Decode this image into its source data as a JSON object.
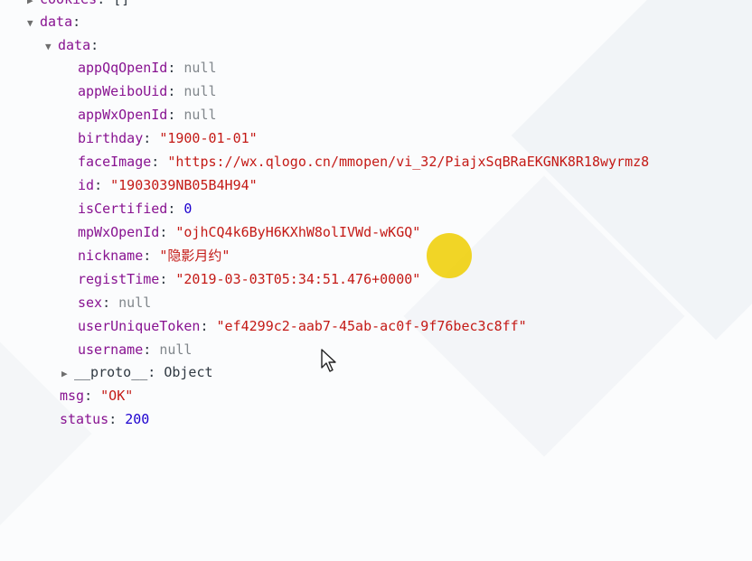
{
  "cookies": {
    "key": "cookies",
    "value": "[]"
  },
  "data_outer": {
    "key": "data"
  },
  "data_inner": {
    "key": "data"
  },
  "fields": [
    {
      "key": "appQqOpenId",
      "value": "null",
      "type": "null"
    },
    {
      "key": "appWeiboUid",
      "value": "null",
      "type": "null"
    },
    {
      "key": "appWxOpenId",
      "value": "null",
      "type": "null"
    },
    {
      "key": "birthday",
      "value": "\"1900-01-01\"",
      "type": "str"
    },
    {
      "key": "faceImage",
      "value": "\"https://wx.qlogo.cn/mmopen/vi_32/PiajxSqBRaEKGNK8R18wyrmz8",
      "type": "str"
    },
    {
      "key": "id",
      "value": "\"1903039NB05B4H94\"",
      "type": "str"
    },
    {
      "key": "isCertified",
      "value": "0",
      "type": "num"
    },
    {
      "key": "mpWxOpenId",
      "value": "\"ojhCQ4k6ByH6KXhW8olIVWd-wKGQ\"",
      "type": "str"
    },
    {
      "key": "nickname",
      "value": "\"隐影月约\"",
      "type": "str"
    },
    {
      "key": "registTime",
      "value": "\"2019-03-03T05:34:51.476+0000\"",
      "type": "str"
    },
    {
      "key": "sex",
      "value": "null",
      "type": "null"
    },
    {
      "key": "userUniqueToken",
      "value": "\"ef4299c2-aab7-45ab-ac0f-9f76bec3c8ff\"",
      "type": "str"
    },
    {
      "key": "username",
      "value": "null",
      "type": "null"
    }
  ],
  "proto": {
    "key": "__proto__",
    "value": "Object"
  },
  "msg": {
    "key": "msg",
    "value": "\"OK\""
  },
  "status": {
    "key": "status",
    "value": "200"
  },
  "icons": {
    "expanded": "triangle-down",
    "collapsed": "triangle-right"
  }
}
